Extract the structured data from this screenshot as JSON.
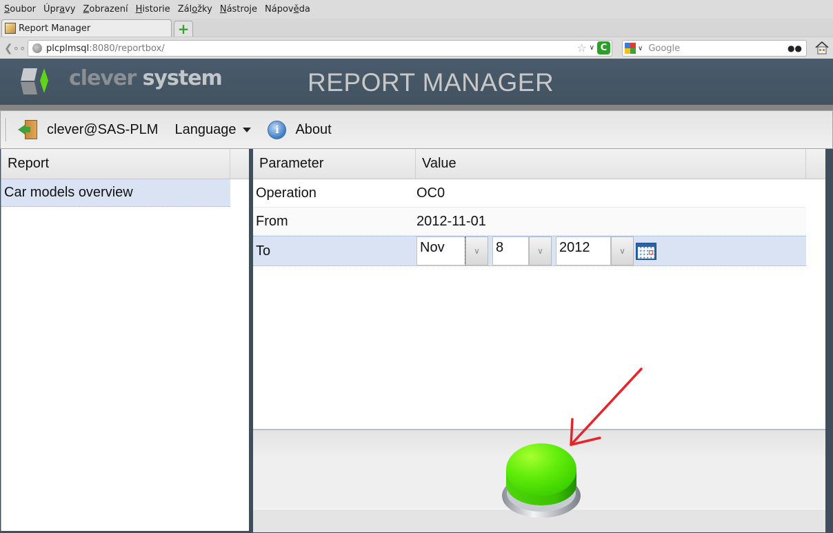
{
  "browser": {
    "menu": [
      {
        "label": "Soubor",
        "accel_index": 0
      },
      {
        "label": "Úpravy",
        "accel_index": 3
      },
      {
        "label": "Zobrazení",
        "accel_index": 0
      },
      {
        "label": "Historie",
        "accel_index": 0
      },
      {
        "label": "Záložky",
        "accel_index": 3
      },
      {
        "label": "Nástroje",
        "accel_index": 0
      },
      {
        "label": "Nápověda",
        "accel_index": 5
      }
    ],
    "tab_title": "Report Manager",
    "new_tab_label": "+",
    "url_host": "plcplmsql",
    "url_rest": ":8080/reportbox/",
    "search_placeholder": "Google",
    "icons": {
      "back": "back-arrow-icon",
      "site": "globe-icon",
      "bookmark": "star-icon",
      "reload": "reload-icon",
      "search_engine": "google-icon",
      "search": "binoculars-icon",
      "home": "home-icon"
    }
  },
  "header": {
    "logo_word1": "clever",
    "logo_word2": "system",
    "title": "REPORT MANAGER",
    "colors": {
      "background": "#445566",
      "logo_accent": "#5fd41a"
    }
  },
  "toolbar": {
    "user": "clever@SAS-PLM",
    "language": "Language",
    "about": "About"
  },
  "reports": {
    "header": "Report",
    "items": [
      {
        "label": "Car models overview",
        "selected": true
      }
    ]
  },
  "parameters": {
    "columns": [
      "Parameter",
      "Value"
    ],
    "rows": [
      {
        "name": "Operation",
        "value": "OC0"
      },
      {
        "name": "From",
        "value": "2012-11-01"
      },
      {
        "name": "To",
        "month": "Nov",
        "day": "8",
        "year": "2012",
        "selected": true
      }
    ]
  },
  "run_button": {
    "color": "#55e60a",
    "label": "run-report"
  },
  "annotation": {
    "color": "#e8232a"
  }
}
